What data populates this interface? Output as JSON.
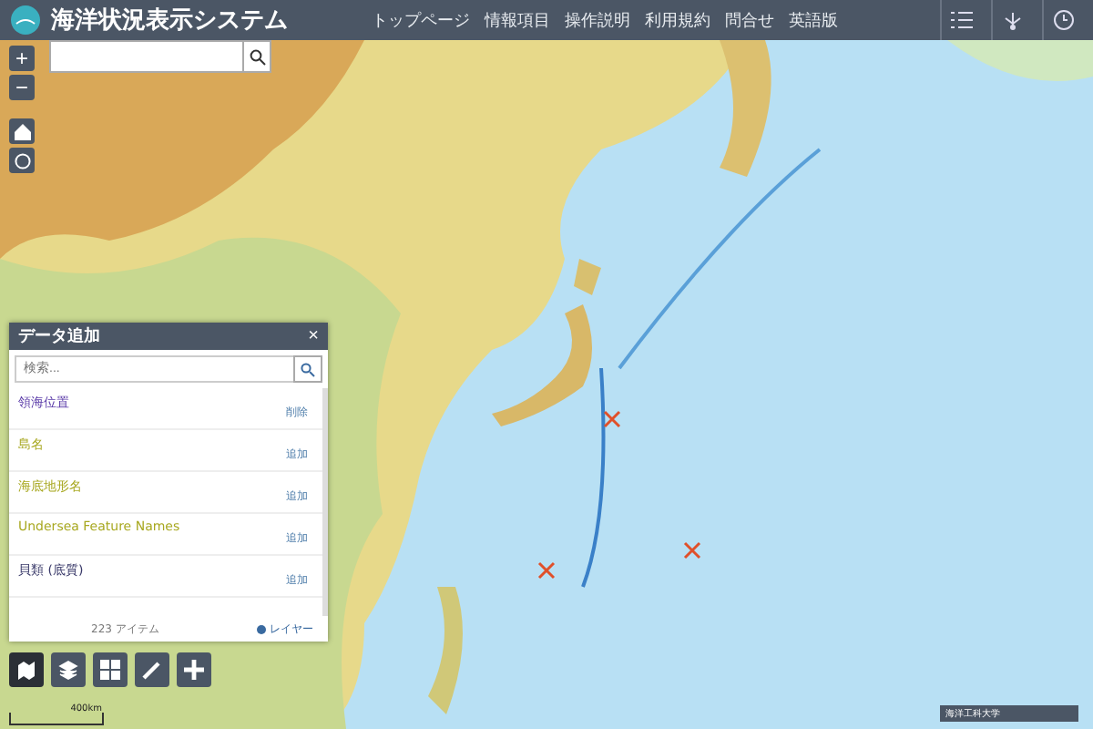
{
  "header": {
    "title": "海洋状況表示システム",
    "nav": [
      "トップページ",
      "情報項目",
      "操作説明",
      "利用規約",
      "問合せ",
      "英語版"
    ]
  },
  "map_controls": {
    "zoom_in": "+",
    "zoom_out": "−"
  },
  "data_panel": {
    "title": "データ追加",
    "close": "×",
    "search_placeholder": "検索...",
    "items": [
      {
        "name": "領海位置",
        "action": "削除",
        "color": "#5a3aa8"
      },
      {
        "name": "島名",
        "action": "追加",
        "color": "#a8a820"
      },
      {
        "name": "海底地形名",
        "action": "追加",
        "color": "#a8a820"
      },
      {
        "name": "Undersea Feature Names",
        "action": "追加",
        "color": "#a8a820"
      },
      {
        "name": "貝類 (底質)",
        "action": "追加",
        "color": "#3a3a6a"
      }
    ],
    "count": "223 アイテム",
    "layer_link": "レイヤー"
  },
  "scale": "400km",
  "attribution": "海洋工科大学"
}
